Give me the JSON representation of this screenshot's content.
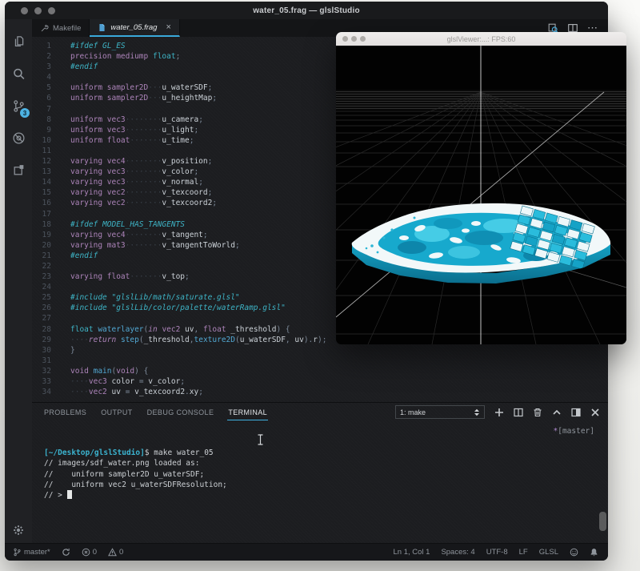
{
  "window": {
    "title": "water_05.frag — glslStudio",
    "tabs": [
      {
        "label": "Makefile",
        "icon": "wrench-icon",
        "active": false
      },
      {
        "label": "water_05.frag",
        "icon": "shader-file-icon",
        "active": true,
        "close_glyph": "×"
      }
    ],
    "editor_actions": {
      "more_glyph": "⋯"
    }
  },
  "activity_bar": {
    "items": [
      {
        "name": "explorer",
        "icon": "files-icon"
      },
      {
        "name": "search",
        "icon": "search-icon"
      },
      {
        "name": "source-control",
        "icon": "git-branch-icon",
        "badge": "3"
      },
      {
        "name": "debug",
        "icon": "debug-icon"
      },
      {
        "name": "extensions",
        "icon": "extensions-icon"
      }
    ],
    "bottom": {
      "name": "settings",
      "icon": "gear-icon"
    }
  },
  "editor": {
    "language": "GLSL",
    "lines": [
      {
        "n": 1,
        "s": [
          [
            "d",
            "#ifdef GL_ES"
          ]
        ]
      },
      {
        "n": 2,
        "s": [
          [
            "k",
            "precision "
          ],
          [
            "k",
            "mediump "
          ],
          [
            "t",
            "float"
          ],
          [
            "p",
            ";"
          ]
        ]
      },
      {
        "n": 3,
        "s": [
          [
            "d",
            "#endif"
          ]
        ]
      },
      {
        "n": 4,
        "s": []
      },
      {
        "n": 5,
        "s": [
          [
            "k",
            "uniform "
          ],
          [
            "k",
            "sampler2D"
          ],
          [
            "w",
            "   "
          ],
          [
            "v",
            "u_waterSDF"
          ],
          [
            "p",
            ";"
          ]
        ]
      },
      {
        "n": 6,
        "s": [
          [
            "k",
            "uniform "
          ],
          [
            "k",
            "sampler2D"
          ],
          [
            "w",
            "   "
          ],
          [
            "v",
            "u_heightMap"
          ],
          [
            "p",
            ";"
          ]
        ]
      },
      {
        "n": 7,
        "s": []
      },
      {
        "n": 8,
        "s": [
          [
            "k",
            "uniform "
          ],
          [
            "k",
            "vec3"
          ],
          [
            "w",
            "        "
          ],
          [
            "v",
            "u_camera"
          ],
          [
            "p",
            ";"
          ]
        ]
      },
      {
        "n": 9,
        "s": [
          [
            "k",
            "uniform "
          ],
          [
            "k",
            "vec3"
          ],
          [
            "w",
            "        "
          ],
          [
            "v",
            "u_light"
          ],
          [
            "p",
            ";"
          ]
        ]
      },
      {
        "n": 10,
        "s": [
          [
            "k",
            "uniform "
          ],
          [
            "k",
            "float"
          ],
          [
            "w",
            "       "
          ],
          [
            "v",
            "u_time"
          ],
          [
            "p",
            ";"
          ]
        ]
      },
      {
        "n": 11,
        "s": []
      },
      {
        "n": 12,
        "s": [
          [
            "k",
            "varying "
          ],
          [
            "k",
            "vec4"
          ],
          [
            "w",
            "        "
          ],
          [
            "v",
            "v_position"
          ],
          [
            "p",
            ";"
          ]
        ]
      },
      {
        "n": 13,
        "s": [
          [
            "k",
            "varying "
          ],
          [
            "k",
            "vec3"
          ],
          [
            "w",
            "        "
          ],
          [
            "v",
            "v_color"
          ],
          [
            "p",
            ";"
          ]
        ]
      },
      {
        "n": 14,
        "s": [
          [
            "k",
            "varying "
          ],
          [
            "k",
            "vec3"
          ],
          [
            "w",
            "        "
          ],
          [
            "v",
            "v_normal"
          ],
          [
            "p",
            ";"
          ]
        ]
      },
      {
        "n": 15,
        "s": [
          [
            "k",
            "varying "
          ],
          [
            "k",
            "vec2"
          ],
          [
            "w",
            "        "
          ],
          [
            "v",
            "v_texcoord"
          ],
          [
            "p",
            ";"
          ]
        ]
      },
      {
        "n": 16,
        "s": [
          [
            "k",
            "varying "
          ],
          [
            "k",
            "vec2"
          ],
          [
            "w",
            "        "
          ],
          [
            "v",
            "v_texcoord2"
          ],
          [
            "p",
            ";"
          ]
        ]
      },
      {
        "n": 17,
        "s": []
      },
      {
        "n": 18,
        "s": [
          [
            "d",
            "#ifdef MODEL_HAS_TANGENTS"
          ]
        ]
      },
      {
        "n": 19,
        "s": [
          [
            "k",
            "varying "
          ],
          [
            "k",
            "vec4"
          ],
          [
            "w",
            "        "
          ],
          [
            "v",
            "v_tangent"
          ],
          [
            "p",
            ";"
          ]
        ]
      },
      {
        "n": 20,
        "s": [
          [
            "k",
            "varying "
          ],
          [
            "k",
            "mat3"
          ],
          [
            "w",
            "        "
          ],
          [
            "v",
            "v_tangentToWorld"
          ],
          [
            "p",
            ";"
          ]
        ]
      },
      {
        "n": 21,
        "s": [
          [
            "d",
            "#endif"
          ]
        ]
      },
      {
        "n": 22,
        "s": []
      },
      {
        "n": 23,
        "s": [
          [
            "k",
            "varying "
          ],
          [
            "k",
            "float"
          ],
          [
            "w",
            "       "
          ],
          [
            "v",
            "v_top"
          ],
          [
            "p",
            ";"
          ]
        ]
      },
      {
        "n": 24,
        "s": []
      },
      {
        "n": 25,
        "s": [
          [
            "d",
            "#include "
          ],
          [
            "s",
            "\"glslLib/math/saturate.glsl\""
          ]
        ]
      },
      {
        "n": 26,
        "s": [
          [
            "d",
            "#include "
          ],
          [
            "s",
            "\"glslLib/color/palette/waterRamp.glsl\""
          ]
        ]
      },
      {
        "n": 27,
        "s": []
      },
      {
        "n": 28,
        "s": [
          [
            "t",
            "float "
          ],
          [
            "f",
            "waterlayer"
          ],
          [
            "p",
            "("
          ],
          [
            "ki",
            "in "
          ],
          [
            "k",
            "vec2 "
          ],
          [
            "v",
            "uv"
          ],
          [
            "p",
            ", "
          ],
          [
            "k",
            "float "
          ],
          [
            "v",
            "_threshold"
          ],
          [
            "p",
            ") {"
          ]
        ]
      },
      {
        "n": 29,
        "s": [
          [
            "w",
            "    "
          ],
          [
            "ki",
            "return "
          ],
          [
            "f",
            "step"
          ],
          [
            "p",
            "("
          ],
          [
            "v",
            "_threshold"
          ],
          [
            "p",
            ","
          ],
          [
            "f",
            "texture2D"
          ],
          [
            "p",
            "("
          ],
          [
            "v",
            "u_waterSDF"
          ],
          [
            "p",
            ", "
          ],
          [
            "v",
            "uv"
          ],
          [
            "p",
            ")."
          ],
          [
            "v",
            "r"
          ],
          [
            "p",
            ");"
          ]
        ]
      },
      {
        "n": 30,
        "s": [
          [
            "p",
            "}"
          ]
        ]
      },
      {
        "n": 31,
        "s": []
      },
      {
        "n": 32,
        "s": [
          [
            "k",
            "void "
          ],
          [
            "f",
            "main"
          ],
          [
            "p",
            "("
          ],
          [
            "k",
            "void"
          ],
          [
            "p",
            ") {"
          ]
        ]
      },
      {
        "n": 33,
        "s": [
          [
            "w",
            "    "
          ],
          [
            "k",
            "vec3 "
          ],
          [
            "v",
            "color "
          ],
          [
            "p",
            "= "
          ],
          [
            "v",
            "v_color"
          ],
          [
            "p",
            ";"
          ]
        ]
      },
      {
        "n": 34,
        "s": [
          [
            "w",
            "    "
          ],
          [
            "k",
            "vec2 "
          ],
          [
            "v",
            "uv "
          ],
          [
            "p",
            "= "
          ],
          [
            "v",
            "v_texcoord2"
          ],
          [
            "p",
            "."
          ],
          [
            "v",
            "xy"
          ],
          [
            "p",
            ";"
          ]
        ]
      }
    ]
  },
  "panel": {
    "tabs": [
      {
        "label": "PROBLEMS"
      },
      {
        "label": "OUTPUT"
      },
      {
        "label": "DEBUG CONSOLE"
      },
      {
        "label": "TERMINAL"
      }
    ],
    "terminal_select": "1: make",
    "terminal": {
      "lines": [
        [
          [
            "tp",
            "[~/Desktop/glslStudio]"
          ],
          [
            "tw",
            "$ make water_05"
          ]
        ],
        [
          [
            "tw",
            "// images/sdf_water.png loaded as:"
          ]
        ],
        [
          [
            "tw",
            "//    uniform sampler2D u_waterSDF;"
          ]
        ],
        [
          [
            "tw",
            "//    uniform vec2 u_waterSDFResolution;"
          ]
        ],
        [
          [
            "tw",
            "// > "
          ],
          [
            "cursor",
            ""
          ]
        ]
      ],
      "decoration_star": "*",
      "decoration_branch": "[master]"
    }
  },
  "status_bar": {
    "branch": "master*",
    "errors": "0",
    "warnings": "0",
    "cursor": "Ln 1, Col 1",
    "indentation": "Spaces: 4",
    "encoding": "UTF-8",
    "eol": "LF",
    "language": "GLSL"
  },
  "viewer": {
    "title": "glslViewer:...: FPS:60"
  },
  "colors": {
    "accent_blue": "#3aa9da",
    "badge_blue": "#4db2e2",
    "keyword_purple": "#ad84ba",
    "type_teal": "#3eb4c6",
    "function_blue": "#52a8d3",
    "water_cyan": "#2abcdc",
    "terminal_path_cyan": "#3bb3cf"
  }
}
